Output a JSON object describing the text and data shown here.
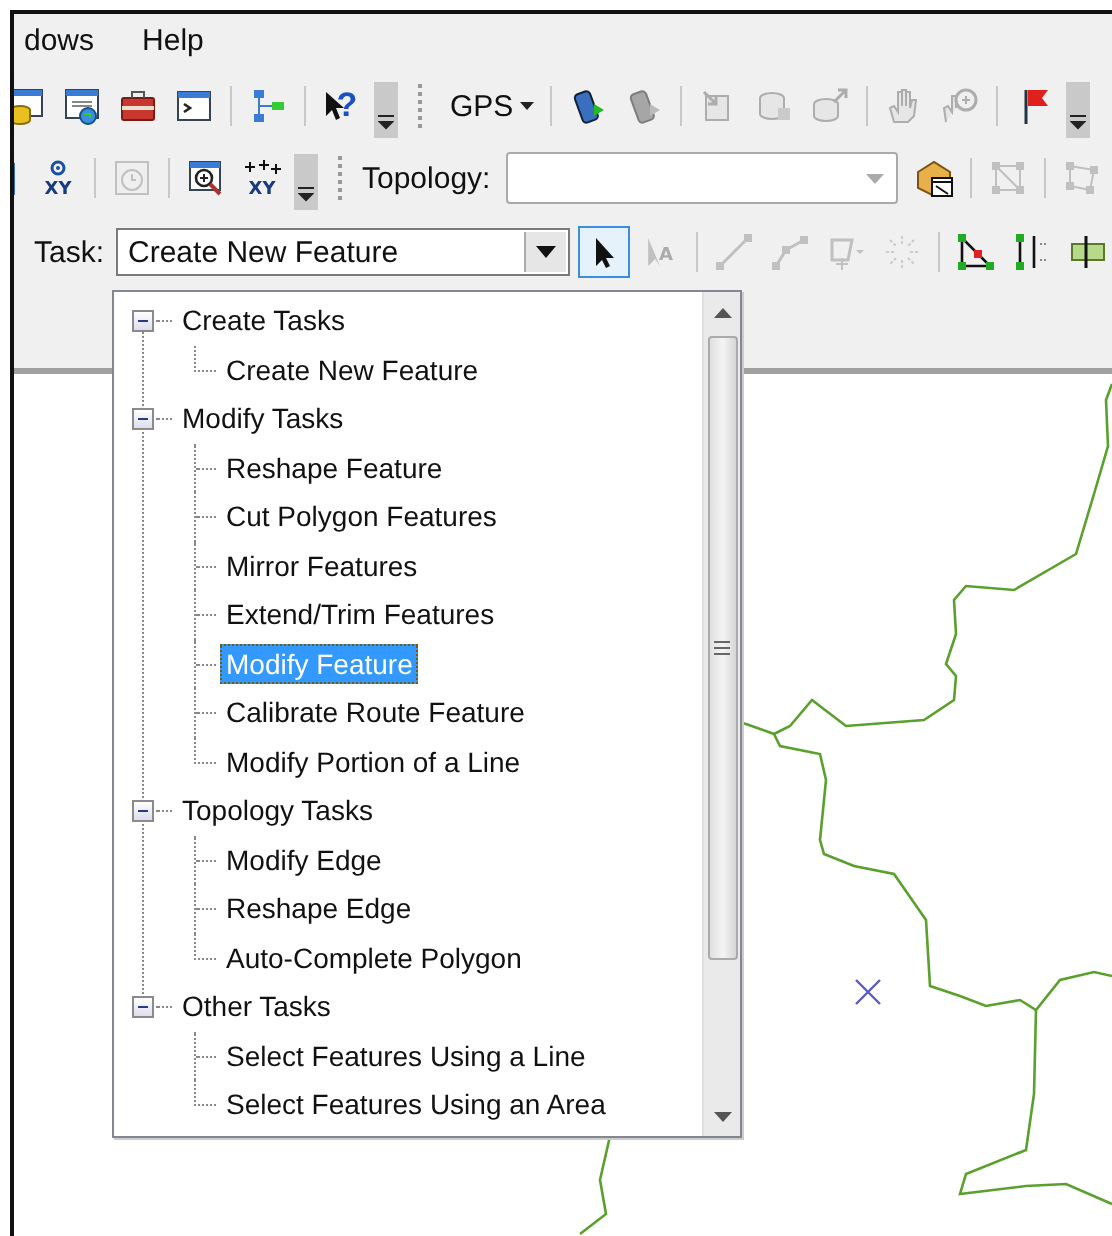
{
  "menu": [
    {
      "label": "dows"
    },
    {
      "label": "Help"
    }
  ],
  "toolbar_1": [
    {
      "kind": "database",
      "disabled": false
    },
    {
      "kind": "globe-window",
      "disabled": false
    },
    {
      "kind": "toolbox",
      "disabled": false
    },
    {
      "kind": "console",
      "disabled": false
    },
    {
      "kind": "sep"
    },
    {
      "kind": "flowchart",
      "disabled": false
    },
    {
      "kind": "sep"
    },
    {
      "kind": "whatsthis",
      "glyph": "?",
      "disabled": false
    },
    {
      "kind": "overflow"
    },
    {
      "kind": "grip"
    },
    {
      "kind": "menu",
      "label": "GPS"
    },
    {
      "kind": "sep"
    },
    {
      "kind": "handheld",
      "disabled": false
    },
    {
      "kind": "handheld",
      "disabled": true
    },
    {
      "kind": "sep"
    },
    {
      "kind": "import",
      "disabled": true
    },
    {
      "kind": "layers",
      "disabled": true
    },
    {
      "kind": "export",
      "disabled": true
    },
    {
      "kind": "sep"
    },
    {
      "kind": "hand",
      "disabled": true
    },
    {
      "kind": "zoom-hand",
      "disabled": true
    },
    {
      "kind": "sep"
    },
    {
      "kind": "flag",
      "disabled": false
    },
    {
      "kind": "overflow"
    }
  ],
  "toolbar_2": [
    {
      "kind": "page",
      "disabled": false
    },
    {
      "kind": "xy-point",
      "glyph": "XY",
      "disabled": false
    },
    {
      "kind": "sep"
    },
    {
      "kind": "clock",
      "disabled": true
    },
    {
      "kind": "sep"
    },
    {
      "kind": "zoom-window",
      "disabled": false
    },
    {
      "kind": "xy-points",
      "glyph": "XY",
      "disabled": false
    },
    {
      "kind": "overflow"
    },
    {
      "kind": "grip"
    },
    {
      "kind": "label",
      "label": "Topology:"
    },
    {
      "kind": "combo"
    },
    {
      "kind": "box",
      "disabled": false
    },
    {
      "kind": "sep"
    },
    {
      "kind": "node-square",
      "disabled": true
    },
    {
      "kind": "sep"
    },
    {
      "kind": "node-shape",
      "disabled": true
    }
  ],
  "task_bar": {
    "label": "Task:",
    "value": "Create New Feature",
    "tools": [
      {
        "kind": "pointer",
        "pressed": true,
        "disabled": false
      },
      {
        "kind": "annotation",
        "glyph": "A",
        "pressed": false,
        "disabled": true
      },
      {
        "kind": "sep"
      },
      {
        "kind": "line",
        "pressed": false,
        "disabled": true
      },
      {
        "kind": "polyline",
        "pressed": false,
        "disabled": true
      },
      {
        "kind": "polygon",
        "pressed": false,
        "disabled": true
      },
      {
        "kind": "points",
        "pressed": false,
        "disabled": true
      },
      {
        "kind": "sep"
      },
      {
        "kind": "triangle",
        "pressed": false,
        "disabled": false
      },
      {
        "kind": "split-line",
        "pressed": false,
        "disabled": false
      },
      {
        "kind": "ruler",
        "pressed": false,
        "disabled": false
      }
    ]
  },
  "task_list": [
    {
      "label": "Create Tasks",
      "expanded": true,
      "selected": false,
      "children": [
        {
          "label": "Create New Feature",
          "selected": false
        }
      ]
    },
    {
      "label": "Modify Tasks",
      "expanded": true,
      "selected": false,
      "children": [
        {
          "label": "Reshape Feature",
          "selected": false
        },
        {
          "label": "Cut Polygon Features",
          "selected": false
        },
        {
          "label": "Mirror Features",
          "selected": false
        },
        {
          "label": "Extend/Trim Features",
          "selected": false
        },
        {
          "label": "Modify Feature",
          "selected": true
        },
        {
          "label": "Calibrate Route Feature",
          "selected": false
        },
        {
          "label": "Modify Portion of a Line",
          "selected": false
        }
      ]
    },
    {
      "label": "Topology Tasks",
      "expanded": true,
      "selected": false,
      "children": [
        {
          "label": "Modify Edge",
          "selected": false
        },
        {
          "label": "Reshape Edge",
          "selected": false
        },
        {
          "label": "Auto-Complete Polygon",
          "selected": false
        }
      ]
    },
    {
      "label": "Other Tasks",
      "expanded": true,
      "selected": false,
      "children": [
        {
          "label": "Select Features Using a Line",
          "selected": false
        },
        {
          "label": "Select Features Using an Area",
          "selected": false
        }
      ]
    }
  ]
}
